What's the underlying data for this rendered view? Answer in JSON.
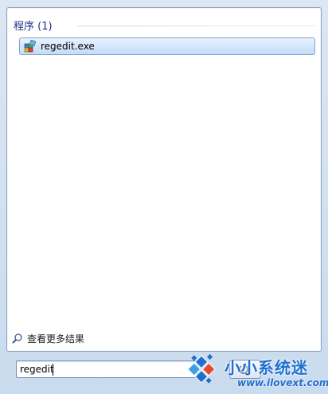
{
  "results": {
    "section_title": "程序 (1)",
    "items": [
      {
        "label": "regedit.exe",
        "icon": "registry-editor-icon"
      }
    ]
  },
  "see_more": {
    "label": "查看更多结果",
    "icon": "magnifier-icon"
  },
  "search": {
    "value": "regedit"
  },
  "shutdown": {
    "icon": "shutdown-icon"
  },
  "watermark": {
    "title": "小小系统迷",
    "url": "www.ilovext.com",
    "color": "#1e6fd0"
  },
  "colors": {
    "section_title": "#1e3287",
    "selection_border": "#7da2ce",
    "frame": "#c9dbee"
  }
}
